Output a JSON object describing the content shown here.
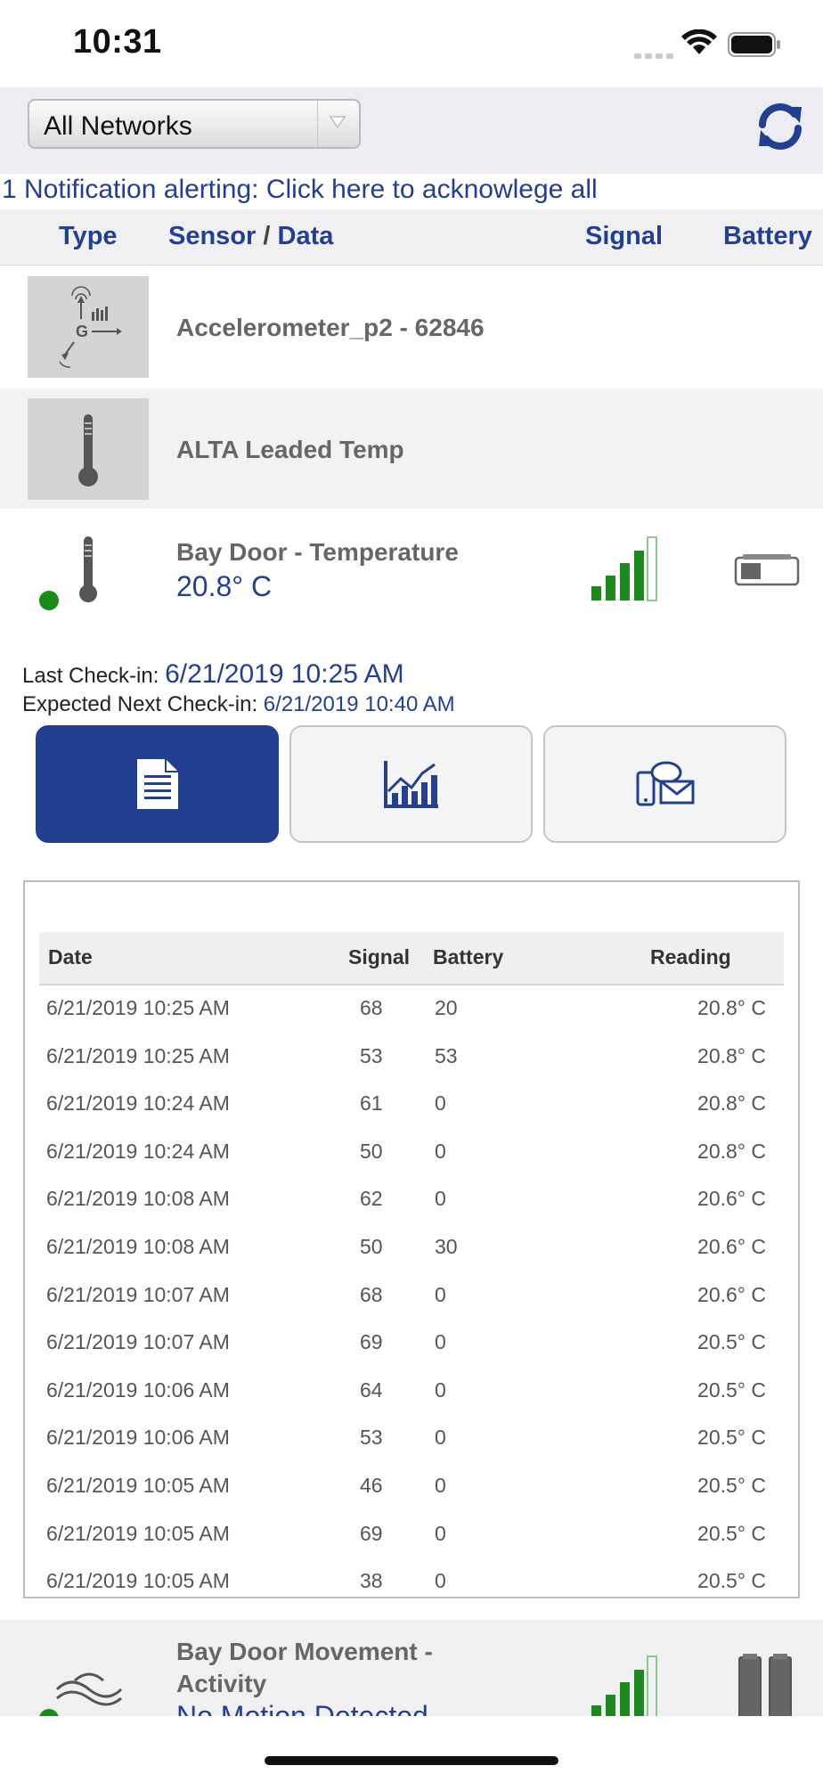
{
  "status_bar": {
    "time": "10:31"
  },
  "network_select": {
    "value": "All Networks"
  },
  "notification": {
    "text": "1 Notification alerting: Click here to acknowlege all"
  },
  "columns": {
    "type": "Type",
    "sensor": "Sensor",
    "sep": "/",
    "data": "Data",
    "signal": "Signal",
    "battery": "Battery"
  },
  "sensors": [
    {
      "name": "Accelerometer_p2 - 62846",
      "icon": "accelerometer-icon"
    },
    {
      "name": "ALTA Leaded Temp",
      "icon": "thermometer-icon"
    },
    {
      "name": "Bay Door - Temperature",
      "reading": "20.8° C",
      "icon": "thermometer-icon",
      "status_color": "#1a8a1a",
      "signal_level": 4,
      "battery_level": 0.3
    },
    {
      "name": "Bay Door Movement - Activity",
      "reading": "No Motion Detected",
      "icon": "motion-icon",
      "signal_level": 4,
      "battery_level": 1.0
    }
  ],
  "checkin": {
    "last_label": "Last Check-in:",
    "last_value": "6/21/2019 10:25 AM",
    "next_label": "Expected Next Check-in:",
    "next_value": "6/21/2019 10:40 AM"
  },
  "detail_tabs": [
    {
      "icon": "document-icon",
      "active": true
    },
    {
      "icon": "chart-icon",
      "active": false
    },
    {
      "icon": "notification-icon",
      "active": false
    }
  ],
  "history": {
    "headers": {
      "date": "Date",
      "signal": "Signal",
      "battery": "Battery",
      "reading": "Reading"
    },
    "rows": [
      {
        "date": "6/21/2019 10:25 AM",
        "signal": "68",
        "battery": "20",
        "reading": "20.8° C"
      },
      {
        "date": "6/21/2019 10:25 AM",
        "signal": "53",
        "battery": "53",
        "reading": "20.8° C"
      },
      {
        "date": "6/21/2019 10:24 AM",
        "signal": "61",
        "battery": "0",
        "reading": "20.8° C"
      },
      {
        "date": "6/21/2019 10:24 AM",
        "signal": "50",
        "battery": "0",
        "reading": "20.8° C"
      },
      {
        "date": "6/21/2019 10:08 AM",
        "signal": "62",
        "battery": "0",
        "reading": "20.6° C"
      },
      {
        "date": "6/21/2019 10:08 AM",
        "signal": "50",
        "battery": "30",
        "reading": "20.6° C"
      },
      {
        "date": "6/21/2019 10:07 AM",
        "signal": "68",
        "battery": "0",
        "reading": "20.6° C"
      },
      {
        "date": "6/21/2019 10:07 AM",
        "signal": "69",
        "battery": "0",
        "reading": "20.5° C"
      },
      {
        "date": "6/21/2019 10:06 AM",
        "signal": "64",
        "battery": "0",
        "reading": "20.5° C"
      },
      {
        "date": "6/21/2019 10:06 AM",
        "signal": "53",
        "battery": "0",
        "reading": "20.5° C"
      },
      {
        "date": "6/21/2019 10:05 AM",
        "signal": "46",
        "battery": "0",
        "reading": "20.5° C"
      },
      {
        "date": "6/21/2019 10:05 AM",
        "signal": "69",
        "battery": "0",
        "reading": "20.5° C"
      },
      {
        "date": "6/21/2019 10:05 AM",
        "signal": "38",
        "battery": "0",
        "reading": "20.5° C"
      }
    ]
  },
  "colors": {
    "brand": "#22408f",
    "signal": "#1c8a1c",
    "header_bg": "#f0f0f2"
  }
}
